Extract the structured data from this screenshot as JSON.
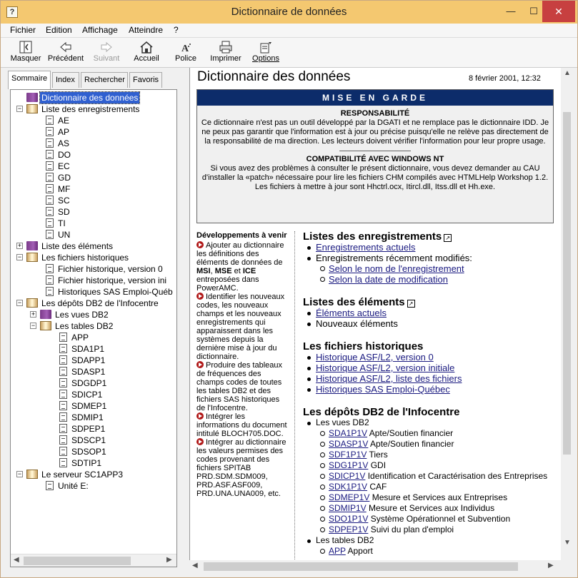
{
  "window": {
    "title": "Dictionnaire de données",
    "min": "—",
    "max": "☐",
    "close": "✕"
  },
  "menu": [
    "Fichier",
    "Edition",
    "Affichage",
    "Atteindre",
    "?"
  ],
  "toolbar": {
    "masquer": "Masquer",
    "precedent": "Précédent",
    "suivant": "Suivant",
    "accueil": "Accueil",
    "police": "Police",
    "imprimer": "Imprimer",
    "options": "Options"
  },
  "tabs": [
    "Sommaire",
    "Index",
    "Rechercher",
    "Favoris"
  ],
  "tree": [
    {
      "label": "Dictionnaire des données",
      "selected": true
    },
    {
      "label": "Liste des enregistrements"
    },
    {
      "label": "AE"
    },
    {
      "label": "AP"
    },
    {
      "label": "AS"
    },
    {
      "label": "DO"
    },
    {
      "label": "EC"
    },
    {
      "label": "GD"
    },
    {
      "label": "MF"
    },
    {
      "label": "SC"
    },
    {
      "label": "SD"
    },
    {
      "label": "TI"
    },
    {
      "label": "UN"
    },
    {
      "label": "Liste des éléments"
    },
    {
      "label": "Les fichiers historiques"
    },
    {
      "label": "Fichier historique, version 0"
    },
    {
      "label": "Fichier historique, version ini"
    },
    {
      "label": "Historiques SAS Emploi-Québ"
    },
    {
      "label": "Les dépôts DB2 de l'Infocentre"
    },
    {
      "label": "Les vues DB2"
    },
    {
      "label": "Les tables DB2"
    },
    {
      "label": "APP"
    },
    {
      "label": "SDA1P1"
    },
    {
      "label": "SDAPP1"
    },
    {
      "label": "SDASP1"
    },
    {
      "label": "SDGDP1"
    },
    {
      "label": "SDICP1"
    },
    {
      "label": "SDMEP1"
    },
    {
      "label": "SDMIP1"
    },
    {
      "label": "SDPEP1"
    },
    {
      "label": "SDSCP1"
    },
    {
      "label": "SDSOP1"
    },
    {
      "label": "SDTIP1"
    },
    {
      "label": "Le serveur SC1APP3"
    },
    {
      "label": "Unité E:"
    }
  ],
  "content": {
    "title": "Dictionnaire des données",
    "date": "8 février 2001, 12:32",
    "warning": {
      "header": "MISE EN GARDE",
      "sec1_title": "RESPONSABILITÉ",
      "sec1_text": "Ce dictionnaire n'est pas un outil développé par la DGATI et ne remplace pas le dictionnaire IDD. Je ne peux pas garantir que l'information est à jour ou précise puisqu'elle ne relève pas directement de la responsabilité de ma direction. Les lecteurs doivent vérifier l'information pour leur propre usage.",
      "sec2_title": "COMPATIBILITÉ AVEC WINDOWS NT",
      "sec2_text": "Si vous avez des problèmes à consulter le présent dictionnaire, vous devez demander au CAU d'installer la «patch» nécessaire pour lire les fichiers CHM compilés avec HTMLHelp Workshop 1.2. Les fichiers à mettre à jour sont Hhctrl.ocx, Itircl.dll, Itss.dll et Hh.exe."
    },
    "dev": {
      "title": "Développements à venir",
      "i1a": "Ajouter au dictionnaire les définitions des éléments de données de ",
      "msi": "MSI",
      "mse": "MSE",
      "ice": "ICE",
      "i1b": " entreposées dans PowerAMC.",
      "i2": "Identifier les nouveaux codes, les nouveaux champs et les nouveaux enregistrements qui apparaissent dans les systèmes depuis la dernière mise à jour du dictionnaire.",
      "i3": "Produire des tableaux de fréquences des champs codes de toutes les tables DB2 et des fichiers SAS historiques de l'Infocentre.",
      "i4": "Intégrer les informations du document intitulé BLOCH705.DOC.",
      "i5": "Intégrer au dictionnaire les valeurs permises des codes provenant des fichiers SPITAB PRD.SDM.SDM009, PRD.ASF.ASF009, PRD.UNA.UNA009, etc."
    },
    "s1": {
      "title": "Listes des enregistrements",
      "l1": "Enregistrements actuels",
      "l2": "Enregistrements récemment modifiés:",
      "l3": "Selon le nom de l'enregistrement",
      "l4": "Selon la date de modification"
    },
    "s2": {
      "title": "Listes des éléments",
      "l1": "Éléments actuels",
      "l2": "Nouveaux éléments"
    },
    "s3": {
      "title": "Les fichiers historiques",
      "l1": "Historique ASF/L2, version 0",
      "l2": "Historique ASF/L2, version initiale",
      "l3": "Historique ASF/L2, liste des fichiers",
      "l4": "Historiques SAS Emploi-Québec"
    },
    "s4": {
      "title": "Les dépôts DB2 de l'Infocentre",
      "vues": "Les vues DB2",
      "tables": "Les tables DB2",
      "items": [
        {
          "code": "SDA1P1V",
          "desc": " Apte/Soutien financier"
        },
        {
          "code": "SDASP1V",
          "desc": " Apte/Soutien financier"
        },
        {
          "code": "SDF1P1V",
          "desc": " Tiers"
        },
        {
          "code": "SDG1P1V",
          "desc": " GDI"
        },
        {
          "code": "SDICP1V",
          "desc": " Identification et Caractérisation des Entreprises"
        },
        {
          "code": "SDK1P1V",
          "desc": " CAF"
        },
        {
          "code": "SDMEP1V",
          "desc": " Mesure et Services aux Entreprises"
        },
        {
          "code": "SDMIP1V",
          "desc": " Mesure et Services aux Individus"
        },
        {
          "code": "SDO1P1V",
          "desc": " Système Opérationnel et Subvention"
        },
        {
          "code": "SDPEP1V",
          "desc": " Suivi du plan d'emploi"
        }
      ],
      "last_code": "APP",
      "last_desc": " Apport"
    }
  }
}
